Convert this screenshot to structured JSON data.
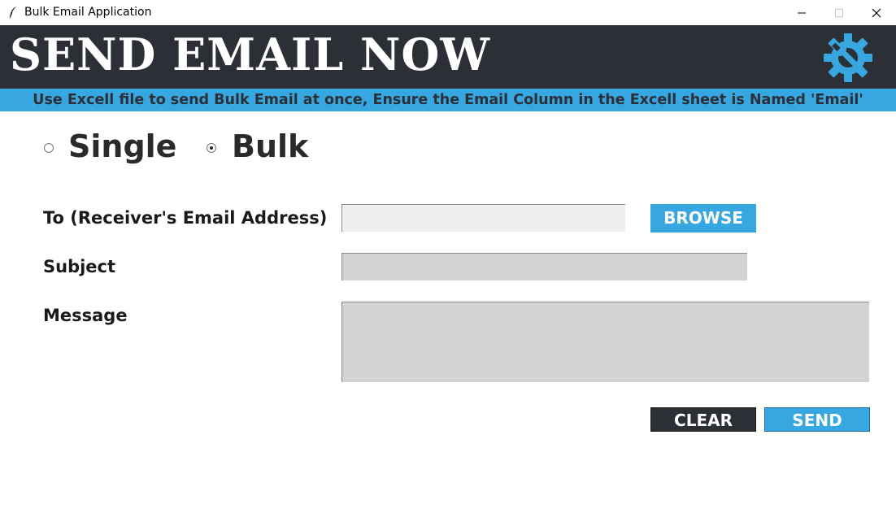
{
  "window": {
    "title": "Bulk Email Application",
    "icon": "feather-icon",
    "controls": [
      "minimize-icon",
      "maximize-icon",
      "close-icon"
    ]
  },
  "header": {
    "title": "SEND EMAIL NOW",
    "icon": "settings-gear-wrench-icon",
    "background_color": "#2c2f36"
  },
  "banner": {
    "text": "Use Excell file to send Bulk Email at once, Ensure the Email Column in the Excell sheet is Named 'Email'",
    "background_color": "#36a7e0"
  },
  "mode": {
    "options": [
      {
        "label": "Single",
        "selected": false
      },
      {
        "label": "Bulk",
        "selected": true
      }
    ]
  },
  "form": {
    "to_label": "To (Receiver's Email Address)",
    "to_value": "",
    "subject_label": "Subject",
    "subject_value": "",
    "message_label": "Message",
    "message_value": ""
  },
  "buttons": {
    "browse": "BROWSE",
    "clear": "CLEAR",
    "send": "SEND"
  },
  "colors": {
    "accent": "#36a7e0",
    "dark": "#2c2f36"
  }
}
